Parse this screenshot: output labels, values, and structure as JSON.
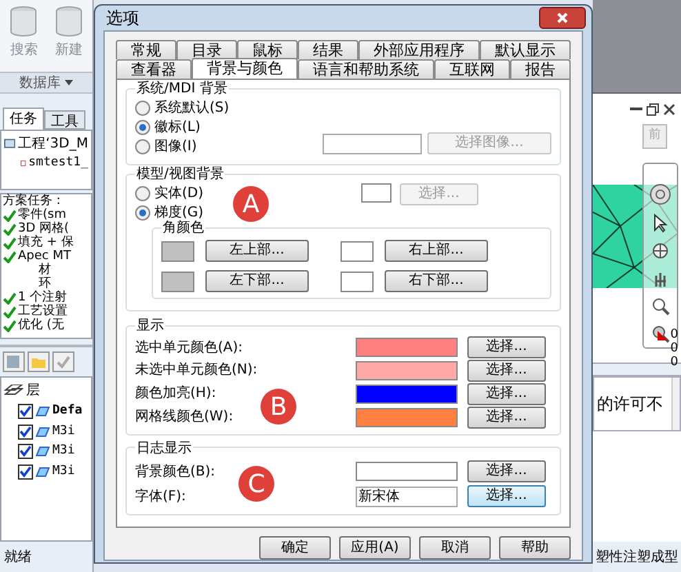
{
  "app": {
    "toolbar": [
      {
        "label": "搜索"
      },
      {
        "label": "新建"
      }
    ],
    "database_menu": "数据库",
    "left_tabs": [
      {
        "label": "任务",
        "selected": true
      },
      {
        "label": "工具",
        "selected": false
      }
    ],
    "project_tree": [
      {
        "label": "工程‘3D_M",
        "children": [
          {
            "label": "smtest1_"
          }
        ]
      }
    ],
    "tasks": [
      {
        "label": "方案任务 :",
        "checked": false,
        "indent": false
      },
      {
        "label": "零件(sm",
        "checked": true,
        "indent": false
      },
      {
        "label": "3D 网格(",
        "checked": true,
        "indent": false
      },
      {
        "label": "填充 + 保",
        "checked": true,
        "indent": false
      },
      {
        "label": "Apec MT",
        "checked": true,
        "indent": false
      },
      {
        "label": "材",
        "checked": false,
        "indent": true
      },
      {
        "label": "环",
        "checked": false,
        "indent": true
      },
      {
        "label": "1 个注射",
        "checked": true,
        "indent": false
      },
      {
        "label": "工艺设置",
        "checked": true,
        "indent": false
      },
      {
        "label": "优化 (无",
        "checked": true,
        "indent": false
      }
    ],
    "layers": {
      "title": "层",
      "items": [
        {
          "label": "Defa",
          "checked": true,
          "bold": true
        },
        {
          "label": "M3i",
          "checked": true,
          "bold": false
        },
        {
          "label": "M3i",
          "checked": true,
          "bold": false
        },
        {
          "label": "M3i",
          "checked": true,
          "bold": false
        }
      ]
    },
    "status": "就绪",
    "view_button": "前",
    "readouts": [
      "0",
      "0",
      "0"
    ],
    "message": "的许可不",
    "status_right": "塑性注塑成型"
  },
  "dialog": {
    "title": "选项",
    "tab_rows": [
      [
        {
          "label": "常规",
          "selected": false
        },
        {
          "label": "目录",
          "selected": false
        },
        {
          "label": "鼠标",
          "selected": false
        },
        {
          "label": "结果",
          "selected": false
        },
        {
          "label": "外部应用程序",
          "selected": false
        },
        {
          "label": "默认显示",
          "selected": false
        }
      ],
      [
        {
          "label": "查看器",
          "selected": false
        },
        {
          "label": "背景与颜色",
          "selected": true
        },
        {
          "label": "语言和帮助系统",
          "selected": false
        },
        {
          "label": "互联网",
          "selected": false
        },
        {
          "label": "报告",
          "selected": false
        }
      ]
    ],
    "mdi_background": {
      "title": "系统/MDI 背景",
      "options": [
        {
          "label": "系统默认(S)",
          "selected": false
        },
        {
          "label": "徽标(L)",
          "selected": true
        },
        {
          "label": "图像(I)",
          "selected": false
        }
      ],
      "image_button": {
        "label": "选择图像...",
        "disabled": true
      }
    },
    "model_background": {
      "title": "模型/视图背景",
      "options": [
        {
          "label": "实体(D)",
          "selected": false
        },
        {
          "label": "梯度(G)",
          "selected": true
        }
      ],
      "solid_button": {
        "label": "选择...",
        "disabled": true
      },
      "corner_title": "角颜色",
      "corners": [
        {
          "label": "左上部...",
          "color": "#c0c0c0"
        },
        {
          "label": "右上部...",
          "color": "#ffffff"
        },
        {
          "label": "左下部...",
          "color": "#c0c0c0"
        },
        {
          "label": "右下部...",
          "color": "#ffffff"
        }
      ]
    },
    "display": {
      "title": "显示",
      "rows": [
        {
          "label": "选中单元颜色(A):",
          "color": "#ff8080",
          "button": "选择...",
          "focused": false
        },
        {
          "label": "未选中单元颜色(N):",
          "color": "#ffa8a8",
          "button": "选择...",
          "focused": false
        },
        {
          "label": "颜色加亮(H):",
          "color": "#0000ff",
          "button": "选择...",
          "focused": false
        },
        {
          "label": "网格线颜色(W):",
          "color": "#ff8040",
          "button": "选择...",
          "focused": false
        }
      ]
    },
    "log_display": {
      "title": "日志显示",
      "rows": [
        {
          "label": "背景颜色(B):",
          "kind": "color",
          "color": "#ffffff",
          "button": "选择...",
          "focused": false
        },
        {
          "label": "字体(F):",
          "kind": "font",
          "value": "新宋体",
          "button": "选择...",
          "focused": true
        }
      ]
    },
    "markers": [
      "A",
      "B",
      "C"
    ],
    "buttons": [
      "确定",
      "应用(A)",
      "取消",
      "帮助"
    ]
  }
}
